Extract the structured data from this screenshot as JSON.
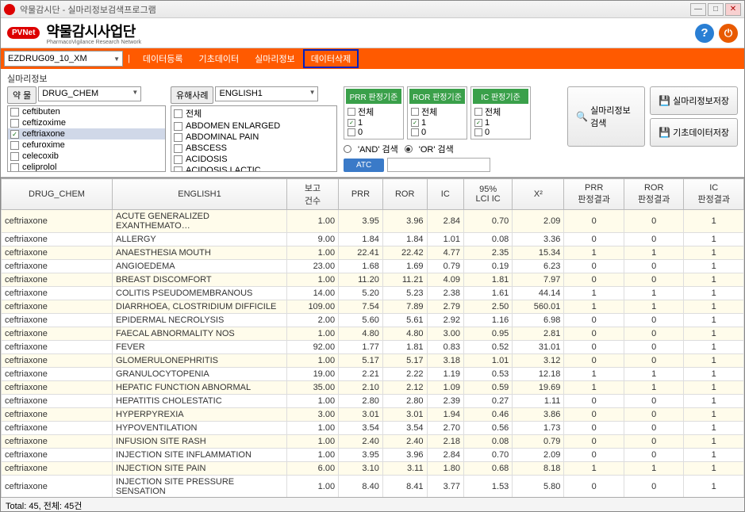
{
  "window": {
    "title": "약물감시단 - 실마리정보검색프로그램"
  },
  "branding": {
    "badge": "PVNet",
    "name": "약물감시사업단",
    "sub": "PharmacoVigilance Research Network"
  },
  "toolbar": {
    "file": "EZDRUG09_10_XM",
    "btns": [
      "데이터등록",
      "기초데이터",
      "실마리정보",
      "데이터삭제"
    ],
    "highlighted_index": 3
  },
  "filter": {
    "section_label": "실마리정보",
    "drug_btn": "약 물",
    "drug_combo": "DRUG_CHEM",
    "event_btn": "유해사례",
    "event_combo": "ENGLISH1",
    "drug_items": [
      {
        "label": "ceftibuten",
        "checked": false
      },
      {
        "label": "ceftizoxime",
        "checked": false
      },
      {
        "label": "ceftriaxone",
        "checked": true,
        "selected": true
      },
      {
        "label": "cefuroxime",
        "checked": false
      },
      {
        "label": "celecoxib",
        "checked": false
      },
      {
        "label": "celiprolol",
        "checked": false
      }
    ],
    "event_items": [
      {
        "label": "전체",
        "checked": false
      },
      {
        "label": "ABDOMEN ENLARGED",
        "checked": false
      },
      {
        "label": "ABDOMINAL PAIN",
        "checked": false
      },
      {
        "label": "ABSCESS",
        "checked": false
      },
      {
        "label": "ACIDOSIS",
        "checked": false
      },
      {
        "label": "ACIDOSIS LACTIC",
        "checked": false
      }
    ],
    "criteria": [
      {
        "head": "PRR 판정기준",
        "items": [
          {
            "l": "전체",
            "c": false
          },
          {
            "l": "1",
            "c": true
          },
          {
            "l": "0",
            "c": false
          }
        ]
      },
      {
        "head": "ROR 판정기준",
        "items": [
          {
            "l": "전체",
            "c": false
          },
          {
            "l": "1",
            "c": true
          },
          {
            "l": "0",
            "c": false
          }
        ]
      },
      {
        "head": "IC 판정기준",
        "items": [
          {
            "l": "전체",
            "c": false
          },
          {
            "l": "1",
            "c": true
          },
          {
            "l": "0",
            "c": false
          }
        ]
      }
    ],
    "radio_and": "'AND' 검색",
    "radio_or": "'OR' 검색",
    "atc_btn": "ATC",
    "search_btn": "실마리정보검색",
    "save1_btn": "실마리정보저장",
    "save2_btn": "기초데이터저장"
  },
  "grid": {
    "headers": [
      "DRUG_CHEM",
      "ENGLISH1",
      "보고\n건수",
      "PRR",
      "ROR",
      "IC",
      "95%\nLCI IC",
      "X²",
      "PRR\n판정결과",
      "ROR\n판정결과",
      "IC\n판정결과"
    ],
    "rows": [
      [
        "ceftriaxone",
        "ACUTE GENERALIZED EXANTHEMATO…",
        "1.00",
        "3.95",
        "3.96",
        "2.84",
        "0.70",
        "2.09",
        "0",
        "0",
        "1"
      ],
      [
        "ceftriaxone",
        "ALLERGY",
        "9.00",
        "1.84",
        "1.84",
        "1.01",
        "0.08",
        "3.36",
        "0",
        "0",
        "1"
      ],
      [
        "ceftriaxone",
        "ANAESTHESIA MOUTH",
        "1.00",
        "22.41",
        "22.42",
        "4.77",
        "2.35",
        "15.34",
        "1",
        "1",
        "1"
      ],
      [
        "ceftriaxone",
        "ANGIOEDEMA",
        "23.00",
        "1.68",
        "1.69",
        "0.79",
        "0.19",
        "6.23",
        "0",
        "0",
        "1"
      ],
      [
        "ceftriaxone",
        "BREAST DISCOMFORT",
        "1.00",
        "11.20",
        "11.21",
        "4.09",
        "1.81",
        "7.97",
        "0",
        "0",
        "1"
      ],
      [
        "ceftriaxone",
        "COLITIS PSEUDOMEMBRANOUS",
        "14.00",
        "5.20",
        "5.23",
        "2.38",
        "1.61",
        "44.14",
        "1",
        "1",
        "1"
      ],
      [
        "ceftriaxone",
        "DIARRHOEA, CLOSTRIDIUM DIFFICILE",
        "109.00",
        "7.54",
        "7.89",
        "2.79",
        "2.50",
        "560.01",
        "1",
        "1",
        "1"
      ],
      [
        "ceftriaxone",
        "EPIDERMAL NECROLYSIS",
        "2.00",
        "5.60",
        "5.61",
        "2.92",
        "1.16",
        "6.98",
        "0",
        "0",
        "1"
      ],
      [
        "ceftriaxone",
        "FAECAL ABNORMALITY NOS",
        "1.00",
        "4.80",
        "4.80",
        "3.00",
        "0.95",
        "2.81",
        "0",
        "0",
        "1"
      ],
      [
        "ceftriaxone",
        "FEVER",
        "92.00",
        "1.77",
        "1.81",
        "0.83",
        "0.52",
        "31.01",
        "0",
        "0",
        "1"
      ],
      [
        "ceftriaxone",
        "GLOMERULONEPHRITIS",
        "1.00",
        "5.17",
        "5.17",
        "3.18",
        "1.01",
        "3.12",
        "0",
        "0",
        "1"
      ],
      [
        "ceftriaxone",
        "GRANULOCYTOPENIA",
        "19.00",
        "2.21",
        "2.22",
        "1.19",
        "0.53",
        "12.18",
        "1",
        "1",
        "1"
      ],
      [
        "ceftriaxone",
        "HEPATIC FUNCTION ABNORMAL",
        "35.00",
        "2.10",
        "2.12",
        "1.09",
        "0.59",
        "19.69",
        "1",
        "1",
        "1"
      ],
      [
        "ceftriaxone",
        "HEPATITIS CHOLESTATIC",
        "1.00",
        "2.80",
        "2.80",
        "2.39",
        "0.27",
        "1.11",
        "0",
        "0",
        "1"
      ],
      [
        "ceftriaxone",
        "HYPERPYREXIA",
        "3.00",
        "3.01",
        "3.01",
        "1.94",
        "0.46",
        "3.86",
        "0",
        "0",
        "1"
      ],
      [
        "ceftriaxone",
        "HYPOVENTILATION",
        "1.00",
        "3.54",
        "3.54",
        "2.70",
        "0.56",
        "1.73",
        "0",
        "0",
        "1"
      ],
      [
        "ceftriaxone",
        "INFUSION SITE RASH",
        "1.00",
        "2.40",
        "2.40",
        "2.18",
        "0.08",
        "0.79",
        "0",
        "0",
        "1"
      ],
      [
        "ceftriaxone",
        "INJECTION SITE INFLAMMATION",
        "1.00",
        "3.95",
        "3.96",
        "2.84",
        "0.70",
        "2.09",
        "0",
        "0",
        "1"
      ],
      [
        "ceftriaxone",
        "INJECTION SITE PAIN",
        "6.00",
        "3.10",
        "3.11",
        "1.80",
        "0.68",
        "8.18",
        "1",
        "1",
        "1"
      ],
      [
        "ceftriaxone",
        "INJECTION SITE PRESSURE SENSATION",
        "1.00",
        "8.40",
        "8.41",
        "3.77",
        "1.53",
        "5.80",
        "0",
        "0",
        "1"
      ]
    ]
  },
  "status": "Total: 45, 전체: 45건"
}
